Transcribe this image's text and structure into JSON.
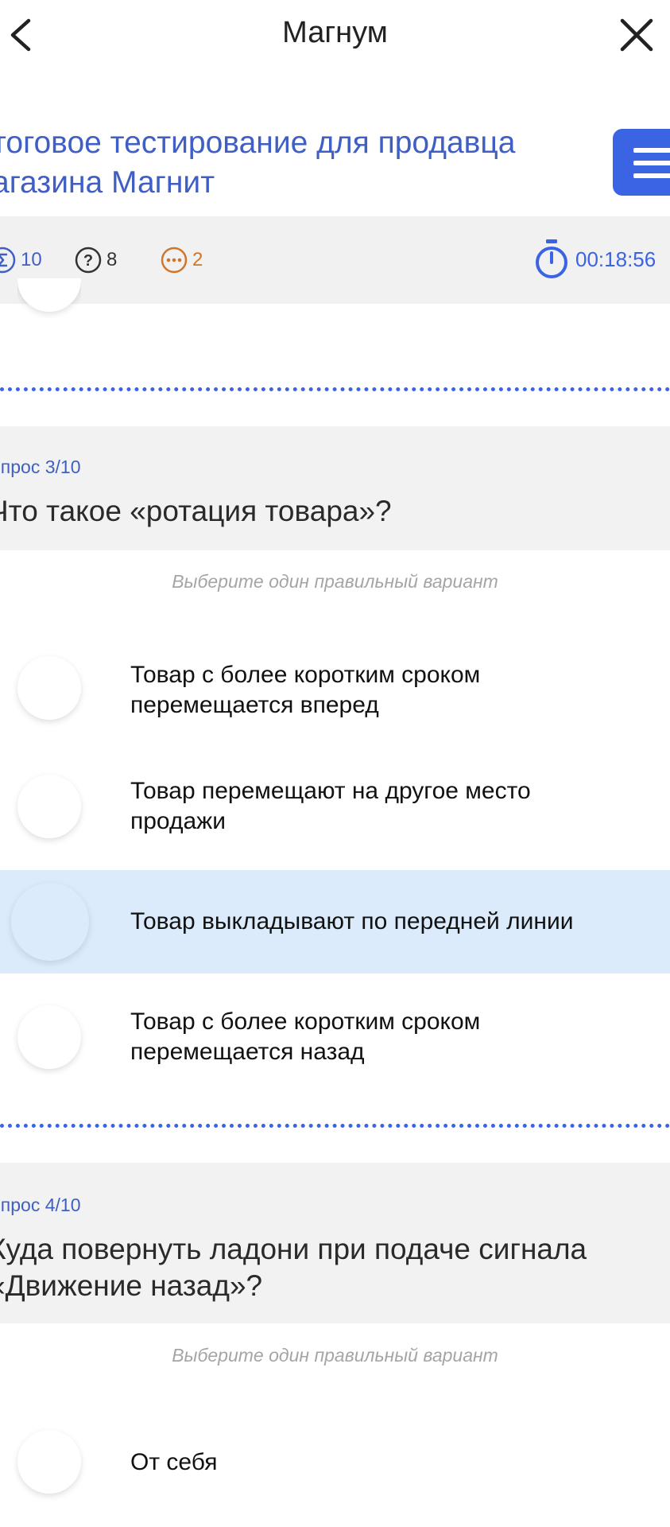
{
  "header": {
    "title": "Магнум",
    "back_icon": "chevron-left-icon",
    "close_icon": "close-icon"
  },
  "test": {
    "title_line1": "тоговое тестирование для продавца",
    "title_line2": "агазина Магнит",
    "menu_icon": "hamburger-menu-icon"
  },
  "status": {
    "total": "10",
    "unanswered": "8",
    "skipped": "2",
    "timer": "00:18:56"
  },
  "questions": [
    {
      "number": "опрос 3/10",
      "text_line1": "Что такое «ротация товара»?",
      "hint": "Выберите один правильный вариант",
      "options": [
        {
          "line1": "Товар с более коротким сроком",
          "line2": "перемещается вперед"
        },
        {
          "line1": "Товар перемещают на другое место",
          "line2": "продажи"
        },
        {
          "line1": "Товар выкладывают по передней линии",
          "line2": ""
        },
        {
          "line1": "Товар с более коротким сроком",
          "line2": "перемещается назад"
        }
      ]
    },
    {
      "number": "опрос 4/10",
      "text_line1": "Куда повернуть ладони при подаче сигнала",
      "text_line2": "«Движение назад»?",
      "hint": "Выберите один правильный вариант",
      "options": [
        {
          "line1": "От себя",
          "line2": ""
        }
      ]
    }
  ],
  "colors": {
    "accent": "#3a64e4",
    "title_blue": "#3f5fc5",
    "selected_bg": "#dcebfc",
    "skipped_orange": "#d0762a"
  }
}
